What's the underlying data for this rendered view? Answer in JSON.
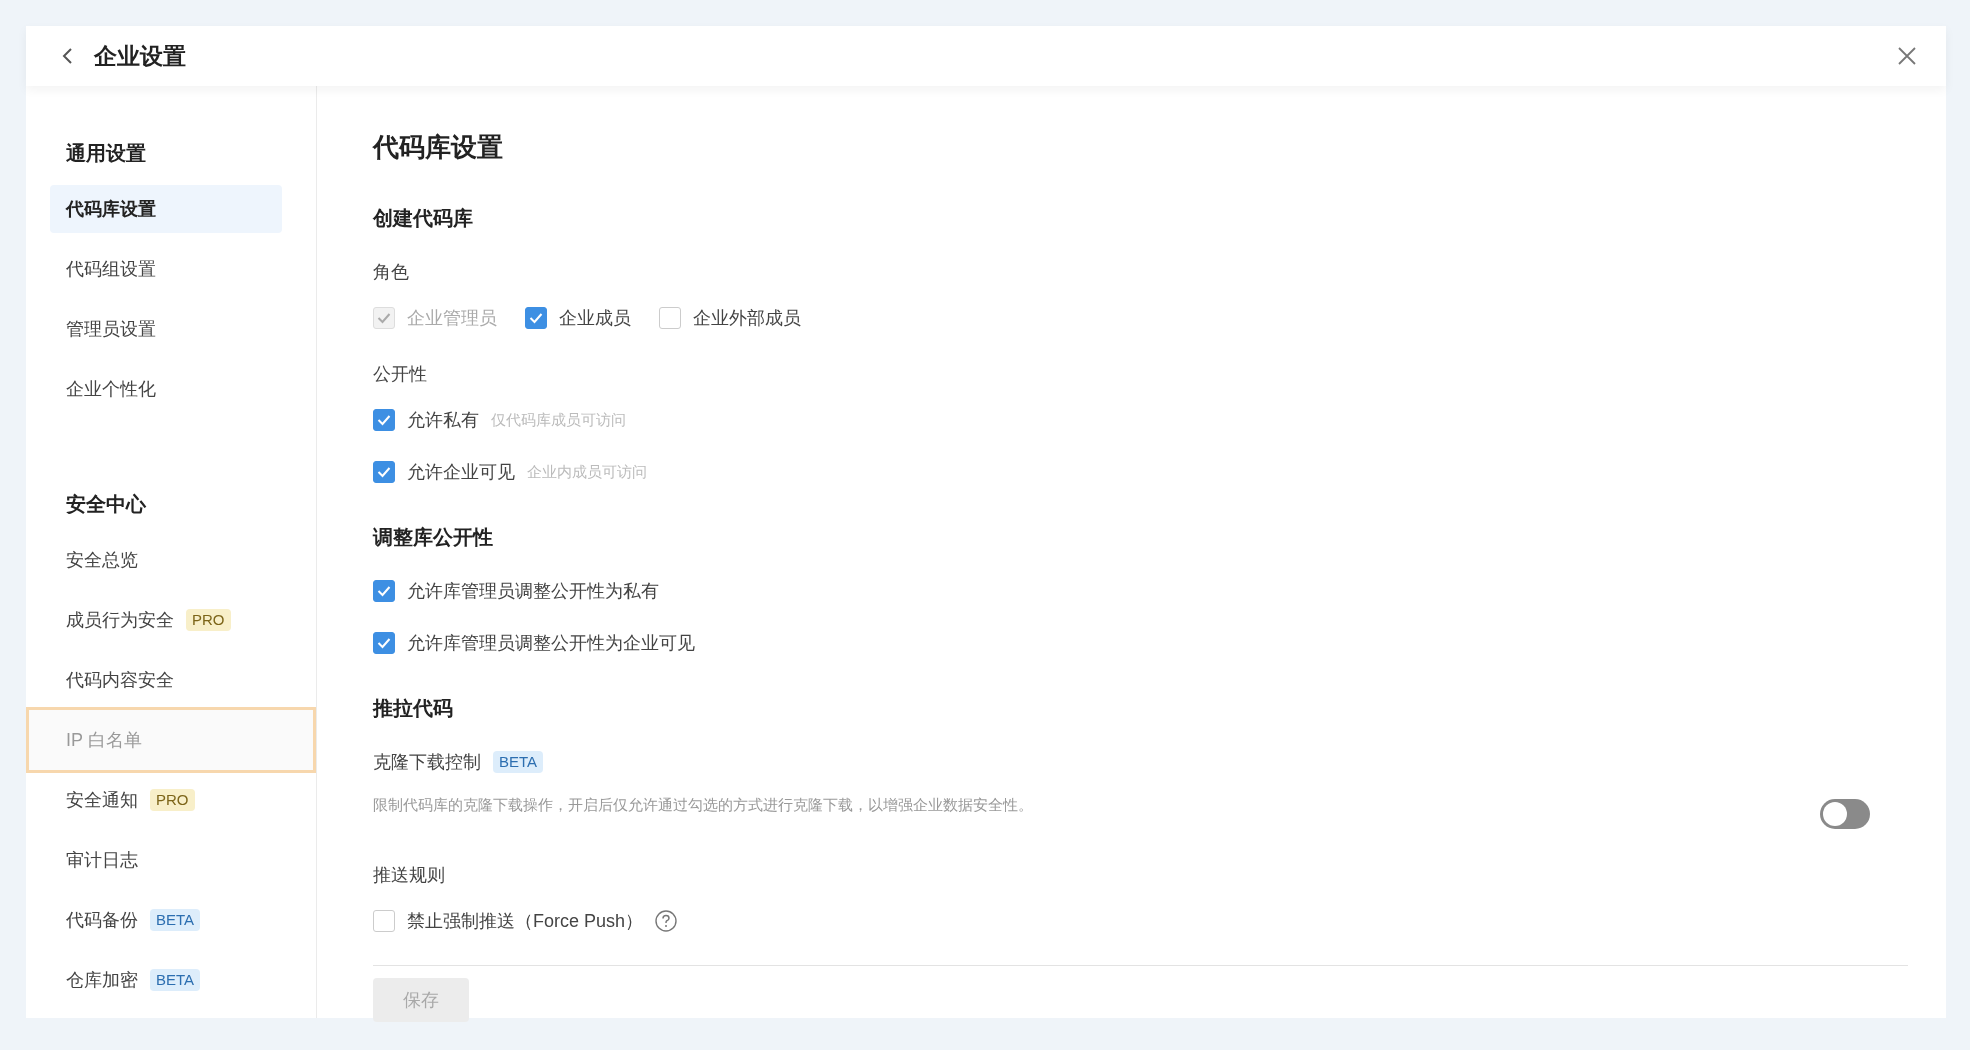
{
  "header": {
    "title": "企业设置"
  },
  "sidebar": {
    "groups": [
      {
        "title": "通用设置",
        "items": [
          {
            "label": "代码库设置",
            "selected": true,
            "focused": false
          },
          {
            "label": "代码组设置",
            "selected": false,
            "focused": false
          },
          {
            "label": "管理员设置",
            "selected": false,
            "focused": false
          },
          {
            "label": "企业个性化",
            "selected": false,
            "focused": false
          }
        ]
      },
      {
        "title": "安全中心",
        "items": [
          {
            "label": "安全总览",
            "selected": false,
            "focused": false
          },
          {
            "label": "成员行为安全",
            "badge": {
              "kind": "pro",
              "label": "PRO"
            },
            "selected": false,
            "focused": false
          },
          {
            "label": "代码内容安全",
            "selected": false,
            "focused": false
          },
          {
            "label": "IP 白名单",
            "selected": false,
            "focused": true
          },
          {
            "label": "安全通知",
            "badge": {
              "kind": "pro",
              "label": "PRO"
            },
            "selected": false,
            "focused": false
          },
          {
            "label": "审计日志",
            "selected": false,
            "focused": false
          },
          {
            "label": "代码备份",
            "badge": {
              "kind": "beta",
              "label": "BETA"
            },
            "selected": false,
            "focused": false
          },
          {
            "label": "仓库加密",
            "badge": {
              "kind": "beta",
              "label": "BETA"
            },
            "selected": false,
            "focused": false
          }
        ]
      }
    ]
  },
  "page": {
    "title": "代码库设置",
    "sections": [
      {
        "heading": "创建代码库",
        "groups": [
          {
            "kind": "checkbox_row",
            "label": "角色",
            "options": [
              {
                "label": "企业管理员",
                "checked": true,
                "disabled": true
              },
              {
                "label": "企业成员",
                "checked": true,
                "disabled": false
              },
              {
                "label": "企业外部成员",
                "checked": false,
                "disabled": false
              }
            ]
          },
          {
            "kind": "checkbox_list",
            "label": "公开性",
            "options": [
              {
                "label": "允许私有",
                "hint": "仅代码库成员可访问",
                "checked": true,
                "disabled": false
              },
              {
                "label": "允许企业可见",
                "hint": "企业内成员可访问",
                "checked": true,
                "disabled": false
              }
            ]
          }
        ]
      },
      {
        "heading": "调整库公开性",
        "groups": [
          {
            "kind": "checkbox_list",
            "options": [
              {
                "label": "允许库管理员调整公开性为私有",
                "checked": true,
                "disabled": false
              },
              {
                "label": "允许库管理员调整公开性为企业可见",
                "checked": true,
                "disabled": false
              }
            ]
          }
        ]
      },
      {
        "heading": "推拉代码",
        "groups": [
          {
            "kind": "switch",
            "label": "克隆下载控制",
            "badge": {
              "kind": "beta",
              "label": "BETA"
            },
            "description": "限制代码库的克隆下载操作，开启后仅允许通过勾选的方式进行克隆下载，以增强企业数据安全性。",
            "on": false
          },
          {
            "kind": "checkbox_list",
            "label": "推送规则",
            "options": [
              {
                "label": "禁止强制推送（Force Push）",
                "checked": false,
                "disabled": false,
                "help": true
              }
            ]
          }
        ]
      }
    ]
  },
  "save_button": {
    "label": "保存",
    "disabled": true
  }
}
